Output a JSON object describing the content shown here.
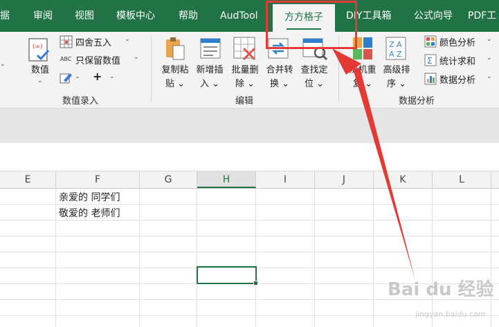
{
  "tabs": [
    {
      "label": "据",
      "active": false
    },
    {
      "label": "审阅",
      "active": false
    },
    {
      "label": "视图",
      "active": false
    },
    {
      "label": "模板中心",
      "active": false
    },
    {
      "label": "帮助",
      "active": false
    },
    {
      "label": "AudTool",
      "active": false
    },
    {
      "label": "方方格子",
      "active": true
    },
    {
      "label": "DIY工具箱",
      "active": false
    },
    {
      "label": "公式向导",
      "active": false
    },
    {
      "label": "PDF工",
      "active": false
    }
  ],
  "ribbon": {
    "group_value_entry": {
      "label": "数值录入",
      "value_button": "数值",
      "round_button": "四舍五入",
      "keep_value_button": "只保留数值",
      "plus_button": "+",
      "abc_text": "ABC"
    },
    "group_edit": {
      "label": "编辑",
      "copy_paste": [
        "复制粘",
        "贴"
      ],
      "insert_new": [
        "新增插",
        "入"
      ],
      "batch_delete": [
        "批量删",
        "除"
      ],
      "merge_convert": [
        "合并转",
        "换"
      ],
      "find_locate": [
        "查找定",
        "位"
      ]
    },
    "group_data_analysis": {
      "label": "数据分析",
      "random_repeat": [
        "随机重",
        "复"
      ],
      "advanced_sort": [
        "高级排",
        "序"
      ],
      "color_analysis": "颜色分析",
      "stats_sum": "统计求和",
      "data_analysis": "数据分析"
    }
  },
  "grid": {
    "columns": [
      "E",
      "F",
      "G",
      "H",
      "I",
      "J",
      "K",
      "L"
    ],
    "selected_column": "H",
    "cells": [
      {
        "text": "亲爱的 同学们"
      },
      {
        "text": "敬爱的 老师们"
      }
    ]
  },
  "watermark": {
    "text": "Bai du 经验",
    "url": "jingyan.baidu.com"
  },
  "colors": {
    "excel_green": "#217346",
    "highlight_red": "#e53935",
    "ribbon_bg": "#f3f3f3"
  }
}
